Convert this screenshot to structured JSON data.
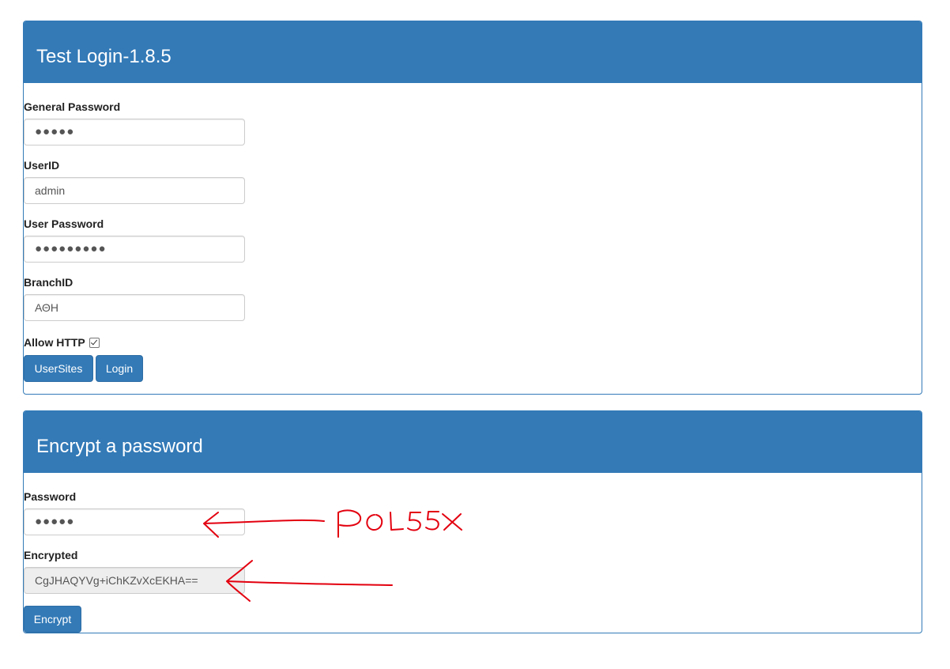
{
  "login_panel": {
    "title": "Test Login-1.8.5",
    "general_password_label": "General Password",
    "general_password_value": "●●●●●",
    "userid_label": "UserID",
    "userid_value": "admin",
    "user_password_label": "User Password",
    "user_password_value": "●●●●●●●●●",
    "branchid_label": "BranchID",
    "branchid_value": "ΑΘΗ",
    "allow_http_label": "Allow HTTP",
    "allow_http_checked": true,
    "usersites_button": "UserSites",
    "login_button": "Login"
  },
  "encrypt_panel": {
    "title": "Encrypt a password",
    "password_label": "Password",
    "password_value": "●●●●●",
    "encrypted_label": "Encrypted",
    "encrypted_value": "CgJHAQYVg+iChKZvXcEKHA==",
    "encrypt_button": "Encrypt"
  },
  "annotation": {
    "handwritten_text": "POL55X",
    "color": "#e3000f"
  },
  "colors": {
    "primary": "#337ab7",
    "primary_border": "#2e6da4"
  }
}
